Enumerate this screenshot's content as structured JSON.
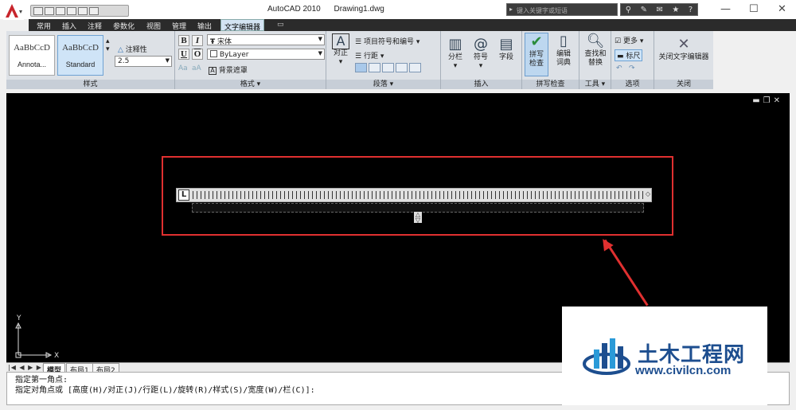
{
  "titlebar": {
    "app_name": "AutoCAD 2010",
    "document": "Drawing1.dwg",
    "search_placeholder": "键入关键字或短语"
  },
  "menu": {
    "tabs": [
      "常用",
      "插入",
      "注释",
      "参数化",
      "视图",
      "管理",
      "输出",
      "文字编辑器"
    ]
  },
  "ribbon": {
    "style_panel": {
      "styles": [
        {
          "sample": "AaBbCcD",
          "name": "Annota..."
        },
        {
          "sample": "AaBbCcD",
          "name": "Standard"
        }
      ],
      "annotative_label": "注释性",
      "height_value": "2.5",
      "footer": "样式"
    },
    "format_panel": {
      "font_value": "宋体",
      "color_value": "ByLayer",
      "background_mask": "背景遮罩",
      "footer": "格式 ▾"
    },
    "paragraph_panel": {
      "justify_label": "对正",
      "bullets_label": "项目符号和编号",
      "line_spacing_label": "行距",
      "footer": "段落 ▾"
    },
    "insert_panel": {
      "columns_label": "分栏",
      "symbol_label": "符号",
      "field_label": "字段",
      "footer": "插入"
    },
    "spell_panel": {
      "spell_check_label": "拼写检查",
      "edit_dict_label": "编辑词典",
      "footer": "拼写检查"
    },
    "tools_panel": {
      "find_replace_label": "查找和替换",
      "footer": "工具 ▾"
    },
    "options_panel": {
      "more_label": "更多",
      "ruler_label": "标尺",
      "footer": "选项"
    },
    "close_panel": {
      "close_label": "关闭文字编辑器",
      "footer": "关闭"
    }
  },
  "drawing": {
    "ucs_y": "Y",
    "ucs_x": "X"
  },
  "layout_tabs": [
    "模型",
    "布局1",
    "布局2"
  ],
  "command_line": {
    "line1": "指定第一角点:",
    "line2": "指定对角点或 [高度(H)/对正(J)/行距(L)/旋转(R)/样式(S)/宽度(W)/栏(C)]:"
  },
  "watermark": {
    "title": "土木工程网",
    "url": "www.civilcn.com"
  },
  "colors": {
    "highlight": "#e03030",
    "watermark": "#1d4e8f"
  }
}
